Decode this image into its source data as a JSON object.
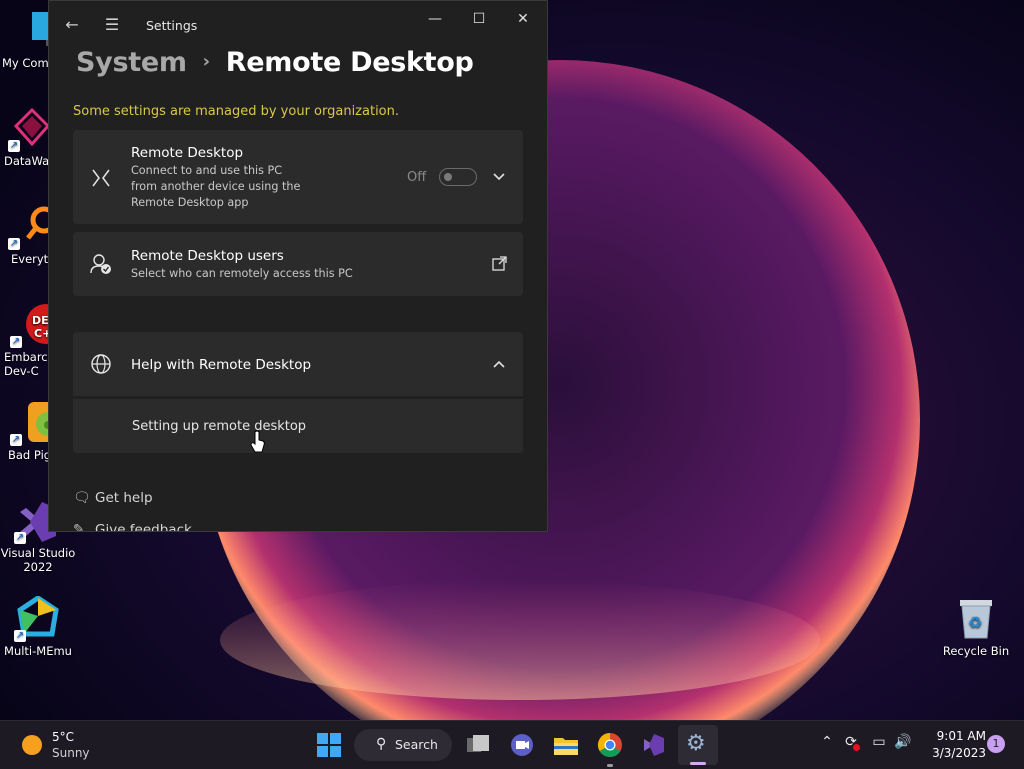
{
  "desktop_icons": [
    {
      "label": "My Com"
    },
    {
      "label": "DataWag"
    },
    {
      "label": "Everyth"
    },
    {
      "label": "Embarca\nDev-C"
    },
    {
      "label": "Bad Pig"
    },
    {
      "label": "Visual Studio\n2022"
    },
    {
      "label": "Multi-MEmu"
    }
  ],
  "recycle_bin": {
    "label": "Recycle Bin"
  },
  "window": {
    "app_title": "Settings",
    "breadcrumb_parent": "System",
    "breadcrumb_separator": "›",
    "breadcrumb_current": "Remote Desktop",
    "org_note": "Some settings are managed by your organization.",
    "remote_desktop_card": {
      "title": "Remote Desktop",
      "description": "Connect to and use this PC from another device using the Remote Desktop app",
      "toggle_state_label": "Off"
    },
    "users_card": {
      "title": "Remote Desktop users",
      "description": "Select who can remotely access this PC"
    },
    "help_card": {
      "title": "Help with Remote Desktop",
      "link": "Setting up remote desktop"
    },
    "footer": {
      "get_help": "Get help",
      "give_feedback": "Give feedback"
    }
  },
  "taskbar": {
    "weather_temp": "5°C",
    "weather_condition": "Sunny",
    "search_label": "Search",
    "time": "9:01 AM",
    "date": "3/3/2023",
    "notification_count": "1"
  },
  "colors": {
    "window_bg": "#202020",
    "card_bg": "#2b2b2b",
    "org_note": "#d9c84c",
    "taskbar_bg": "#1d1a24"
  }
}
